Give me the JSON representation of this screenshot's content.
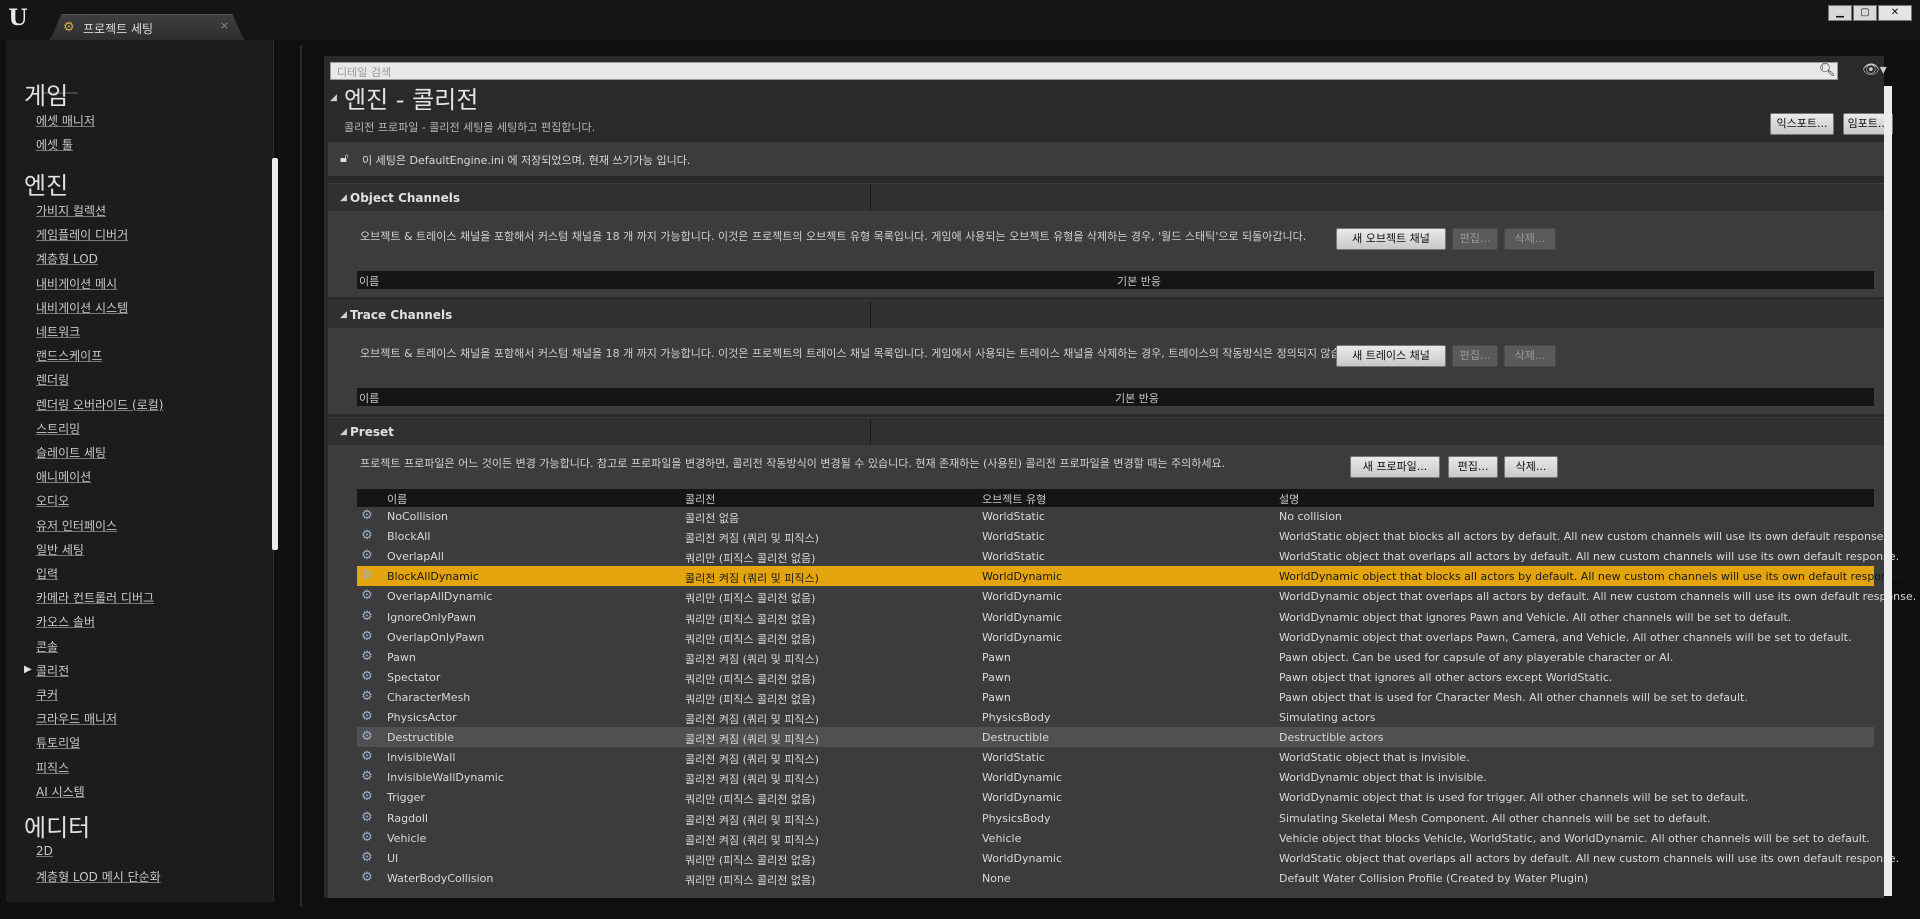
{
  "window": {
    "tab_label": "프로젝트 세팅",
    "tab_close": "×",
    "logo": "U",
    "tab_icon": "gear-icon",
    "controls": {
      "minimize": "▁",
      "maximize": "▢",
      "close": "✕"
    }
  },
  "sidebar": {
    "sections": [
      {
        "label": "게임",
        "items": [
          "에셋 매니저",
          "에셋 툴"
        ]
      },
      {
        "label": "엔진",
        "items": [
          "가비지 컬렉션",
          "게임플레이 디버거",
          "계층형 LOD",
          "내비게이션 메시",
          "내비게이션 시스템",
          "네트워크",
          "랜드스케이프",
          "렌더링",
          "렌더링 오버라이드 (로컬)",
          "스트리밍",
          "슬레이트 세팅",
          "애니메이션",
          "오디오",
          "유저 인터페이스",
          "일반 세팅",
          "입력",
          "카메라 컨트롤러 디버그",
          "카오스 솔버",
          "콘솔",
          "콜리전",
          "쿠커",
          "크라우드 매니저",
          "튜토리얼",
          "피직스",
          "AI 시스템"
        ]
      },
      {
        "label": "에디터",
        "items": [
          "2D",
          "계층형 LOD 메시 단순화"
        ]
      }
    ],
    "selected_item": "콜리전",
    "selected_arrow": "▶"
  },
  "search": {
    "placeholder": "디테일 검색",
    "icon": "search-icon",
    "view_icon": "eye-icon"
  },
  "page": {
    "title": "엔진 - 콜리전",
    "subtitle": "콜리전 프로파일 - 콜리전 세팅을 세팅하고 편집합니다.",
    "export_label": "익스포트...",
    "import_label": "임포트...",
    "info_text": "이 세팅은 DefaultEngine.ini 에 저장되었으며, 현재 쓰기가능 입니다.",
    "collapse": "◢"
  },
  "object_channels": {
    "title": "Object Channels",
    "description": "오브젝트 & 트레이스 채널을 포함해서 커스텀 채널을 18 개 까지 가능합니다. 이것은 프로젝트의 오브젝트 유형 목록입니다. 게임에 사용되는 오브젝트 유형을 삭제하는 경우, '월드 스태틱'으로 되돌아갑니다.",
    "new_button": "새 오브젝트 채널",
    "edit_button": "편집...",
    "delete_button": "삭제...",
    "col_name": "이름",
    "col_default": "기본 반응"
  },
  "trace_channels": {
    "title": "Trace Channels",
    "description": "오브젝트 & 트레이스 채널을 포함해서 커스텀 채널을 18 개 까지 가능합니다. 이것은 프로젝트의 트레이스 채널 목록입니다. 게임에서 사용되는 트레이스 채널을 삭제하는 경우, 트레이스의 작동방식은 정의되지 않습니다.",
    "new_button": "새 트레이스 채널",
    "edit_button": "편집...",
    "delete_button": "삭제...",
    "col_name": "이름",
    "col_default": "기본 반응"
  },
  "preset": {
    "title": "Preset",
    "description": "프로젝트 프로파일은 어느 것이든 변경 가능합니다. 참고로 프로파일을 변경하면, 콜리전 작동방식이 변경될 수 있습니다. 현재 존재하는 (사용된) 콜리전 프로파일을 변경할 때는 주의하세요.",
    "new_button": "새 프로파일...",
    "edit_button": "편집...",
    "delete_button": "삭제...",
    "columns": [
      "이름",
      "콜리전",
      "오브젝트 유형",
      "설명"
    ],
    "rows": [
      [
        "NoCollision",
        "콜리전 없음",
        "WorldStatic",
        "No collision"
      ],
      [
        "BlockAll",
        "콜리전 켜짐 (쿼리 및 피직스)",
        "WorldStatic",
        "WorldStatic object that blocks all actors by default. All new custom channels will use its own default response."
      ],
      [
        "OverlapAll",
        "쿼리만 (피직스 콜리전 없음)",
        "WorldStatic",
        "WorldStatic object that overlaps all actors by default. All new custom channels will use its own default response."
      ],
      [
        "BlockAllDynamic",
        "콜리전 켜짐 (쿼리 및 피직스)",
        "WorldDynamic",
        "WorldDynamic object that blocks all actors by default. All new custom channels will use its own default response."
      ],
      [
        "OverlapAllDynamic",
        "쿼리만 (피직스 콜리전 없음)",
        "WorldDynamic",
        "WorldDynamic object that overlaps all actors by default. All new custom channels will use its own default response."
      ],
      [
        "IgnoreOnlyPawn",
        "쿼리만 (피직스 콜리전 없음)",
        "WorldDynamic",
        "WorldDynamic object that ignores Pawn and Vehicle. All other channels will be set to default."
      ],
      [
        "OverlapOnlyPawn",
        "쿼리만 (피직스 콜리전 없음)",
        "WorldDynamic",
        "WorldDynamic object that overlaps Pawn, Camera, and Vehicle. All other channels will be set to default."
      ],
      [
        "Pawn",
        "콜리전 켜짐 (쿼리 및 피직스)",
        "Pawn",
        "Pawn object. Can be used for capsule of any playerable character or AI."
      ],
      [
        "Spectator",
        "쿼리만 (피직스 콜리전 없음)",
        "Pawn",
        "Pawn object that ignores all other actors except WorldStatic."
      ],
      [
        "CharacterMesh",
        "쿼리만 (피직스 콜리전 없음)",
        "Pawn",
        "Pawn object that is used for Character Mesh. All other channels will be set to default."
      ],
      [
        "PhysicsActor",
        "콜리전 켜짐 (쿼리 및 피직스)",
        "PhysicsBody",
        "Simulating actors"
      ],
      [
        "Destructible",
        "콜리전 켜짐 (쿼리 및 피직스)",
        "Destructible",
        "Destructible actors"
      ],
      [
        "InvisibleWall",
        "콜리전 켜짐 (쿼리 및 피직스)",
        "WorldStatic",
        "WorldStatic object that is invisible."
      ],
      [
        "InvisibleWallDynamic",
        "콜리전 켜짐 (쿼리 및 피직스)",
        "WorldDynamic",
        "WorldDynamic object that is invisible."
      ],
      [
        "Trigger",
        "쿼리만 (피직스 콜리전 없음)",
        "WorldDynamic",
        "WorldDynamic object that is used for trigger. All other channels will be set to default."
      ],
      [
        "Ragdoll",
        "콜리전 켜짐 (쿼리 및 피직스)",
        "PhysicsBody",
        "Simulating Skeletal Mesh Component. All other channels will be set to default."
      ],
      [
        "Vehicle",
        "콜리전 켜짐 (쿼리 및 피직스)",
        "Vehicle",
        "Vehicle object that blocks Vehicle, WorldStatic, and WorldDynamic. All other channels will be set to default."
      ],
      [
        "UI",
        "쿼리만 (피직스 콜리전 없음)",
        "WorldDynamic",
        "WorldStatic object that overlaps all actors by default. All new custom channels will use its own default response."
      ],
      [
        "WaterBodyCollision",
        "쿼리만 (피직스 콜리전 없음)",
        "None",
        "Default Water Collision Profile (Created by Water Plugin)"
      ]
    ],
    "selected_row": 3,
    "hover_row": 11,
    "row_icon": "gear-icon"
  },
  "colors": {
    "selected_row": "#e3a40e",
    "background": "#2a2a2a"
  }
}
